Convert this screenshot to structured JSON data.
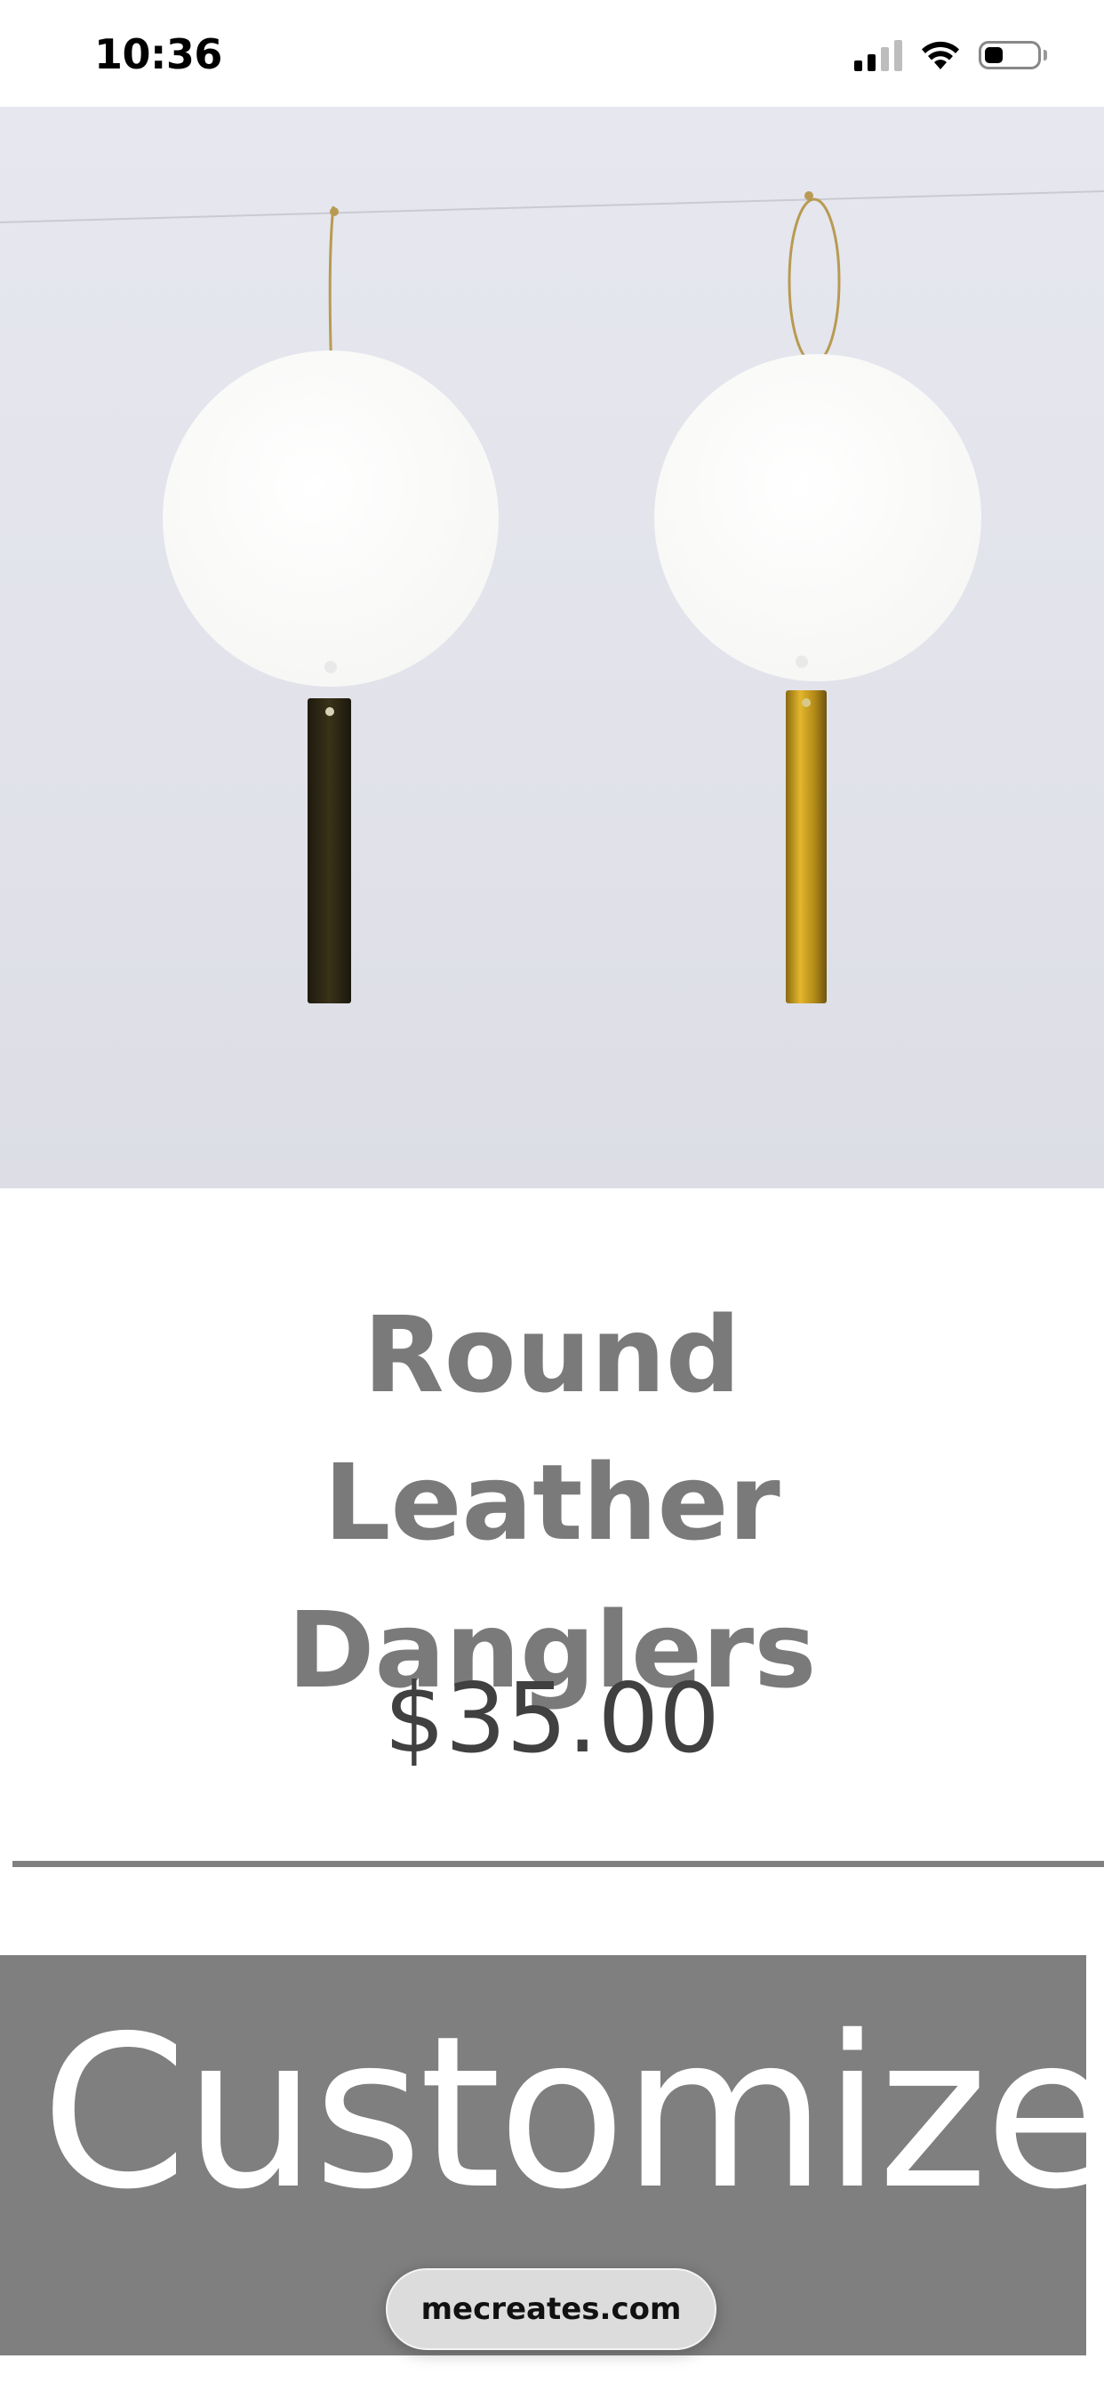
{
  "status_bar": {
    "time": "10:36",
    "icons": [
      "cellular-signal-icon",
      "wifi-icon",
      "battery-icon"
    ]
  },
  "product": {
    "image_alt": "Round leather dangler earrings",
    "title": "Round Leather Danglers",
    "price": "$35.00"
  },
  "actions": {
    "customize_label": "Customize"
  },
  "browser": {
    "url": "mecreates.com"
  },
  "colors": {
    "title": "#7a7a7a",
    "price": "#404040",
    "button_bg": "#7f7f7f",
    "divider": "#808080"
  }
}
